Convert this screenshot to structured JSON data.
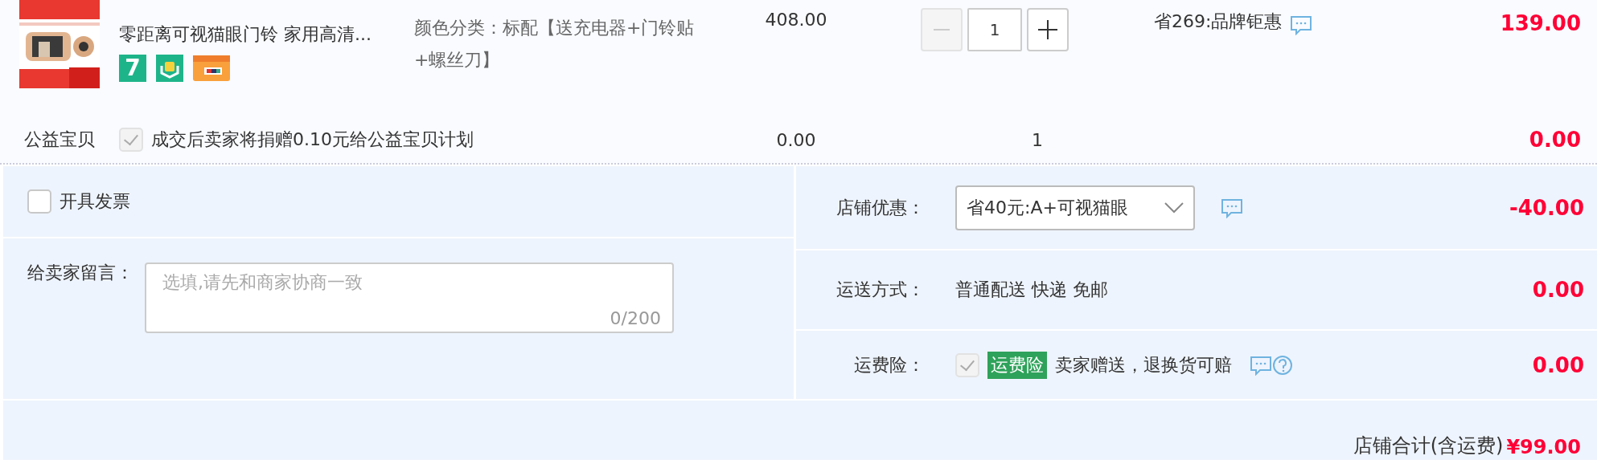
{
  "items": [
    {
      "kind": "product",
      "title": "零距离可视猫眼门铃 家用高清...",
      "badges": [
        {
          "kind": "text",
          "text": "7"
        },
        {
          "kind": "bag"
        },
        {
          "kind": "card"
        }
      ],
      "spec": "颜色分类：标配【送充电器+门铃贴+螺丝刀】",
      "price": "408.00",
      "quantity": {
        "value": "1",
        "minus_disabled": true
      },
      "discount": "省269:品牌钜惠",
      "total": "139.00"
    },
    {
      "kind": "charity",
      "label": "公益宝贝",
      "checked": true,
      "disabled": true,
      "text": "成交后卖家将捐赠0.10元给公益宝贝计划",
      "price": "0.00",
      "quantity": "1",
      "total": "0.00"
    }
  ],
  "invoice": {
    "label": "开具发票",
    "checked": false
  },
  "message": {
    "label": "给卖家留言：",
    "placeholder": "选填,请先和商家协商一致",
    "counter": "0/200"
  },
  "shop_discount": {
    "label": "店铺优惠：",
    "value": "省40元:A+可视猫眼",
    "amount": "-40.00"
  },
  "shipping": {
    "label": "运送方式：",
    "value": "普通配送 快递 免邮",
    "amount": "0.00"
  },
  "insurance": {
    "label": "运费险：",
    "checked": true,
    "disabled": true,
    "tag": "运费险",
    "text": "卖家赠送，退换货可赔",
    "amount": "0.00"
  },
  "store_total": {
    "label": "店铺合计(含运费)",
    "amount": "¥99.00"
  }
}
